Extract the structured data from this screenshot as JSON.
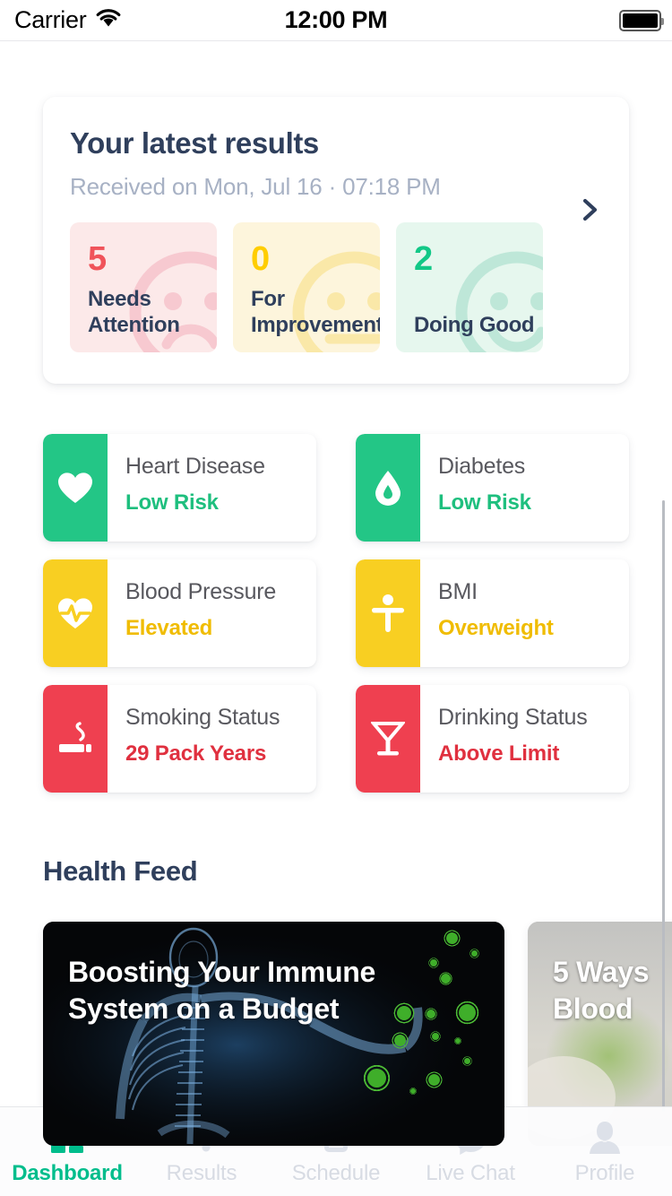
{
  "status_bar": {
    "carrier": "Carrier",
    "wifi_icon": "wifi-icon",
    "time": "12:00 PM",
    "battery_icon": "battery-full-icon"
  },
  "results_card": {
    "title": "Your latest results",
    "subtitle": "Received on Mon, Jul 16  ·  07:18 PM",
    "chevron_icon": "chevron-right-icon",
    "tiles": [
      {
        "count": "5",
        "label": "Needs Attention",
        "bg": "#FCE9E9",
        "count_color": "#F0535A",
        "face": "sad-face-icon",
        "face_color": "#F7C9D0"
      },
      {
        "count": "0",
        "label": "For Improvement",
        "bg": "#FDF5DC",
        "count_color": "#FFCD00",
        "face": "neutral-face-icon",
        "face_color": "#FAE8A8"
      },
      {
        "count": "2",
        "label": "Doing Good",
        "bg": "#E6F7EE",
        "count_color": "#12C887",
        "face": "happy-face-icon",
        "face_color": "#BEE7D8"
      }
    ]
  },
  "risk_cards": [
    {
      "name": "Heart Disease",
      "status": "Low Risk",
      "color": "#23C686",
      "icon": "heart-icon"
    },
    {
      "name": "Diabetes",
      "status": "Low Risk",
      "color": "#23C686",
      "icon": "blood-drop-icon"
    },
    {
      "name": "Blood Pressure",
      "status": "Elevated",
      "color": "#F8CF22",
      "icon": "heart-pulse-icon"
    },
    {
      "name": "BMI",
      "status": "Overweight",
      "color": "#F8CF22",
      "icon": "body-figure-icon"
    },
    {
      "name": "Smoking Status",
      "status": "29 Pack Years",
      "color": "#EF4050",
      "icon": "cigarette-icon"
    },
    {
      "name": "Drinking Status",
      "status": "Above Limit",
      "color": "#EF4050",
      "icon": "cocktail-glass-icon"
    }
  ],
  "health_feed": {
    "section_title": "Health Feed",
    "articles": [
      {
        "headline": "Boosting Your Immune System on a Budget",
        "style": "xray-virus-image"
      },
      {
        "headline": "5 Ways\nBlood",
        "style": "woman-photo-image"
      }
    ]
  },
  "tab_bar": {
    "tabs": [
      {
        "label": "Dashboard",
        "icon": "grid-dashboard-icon",
        "active": true
      },
      {
        "label": "Results",
        "icon": "dots-results-icon",
        "active": false
      },
      {
        "label": "Schedule",
        "icon": "calendar-icon",
        "active": false
      },
      {
        "label": "Live Chat",
        "icon": "chat-bubble-icon",
        "active": false
      },
      {
        "label": "Profile",
        "icon": "person-icon",
        "active": false
      }
    ]
  },
  "theme": {
    "accent_green": "#00bd8c",
    "navy_text": "#2f3f5c",
    "muted_text": "#a7b1c4",
    "page_bg": "#ffffff"
  }
}
